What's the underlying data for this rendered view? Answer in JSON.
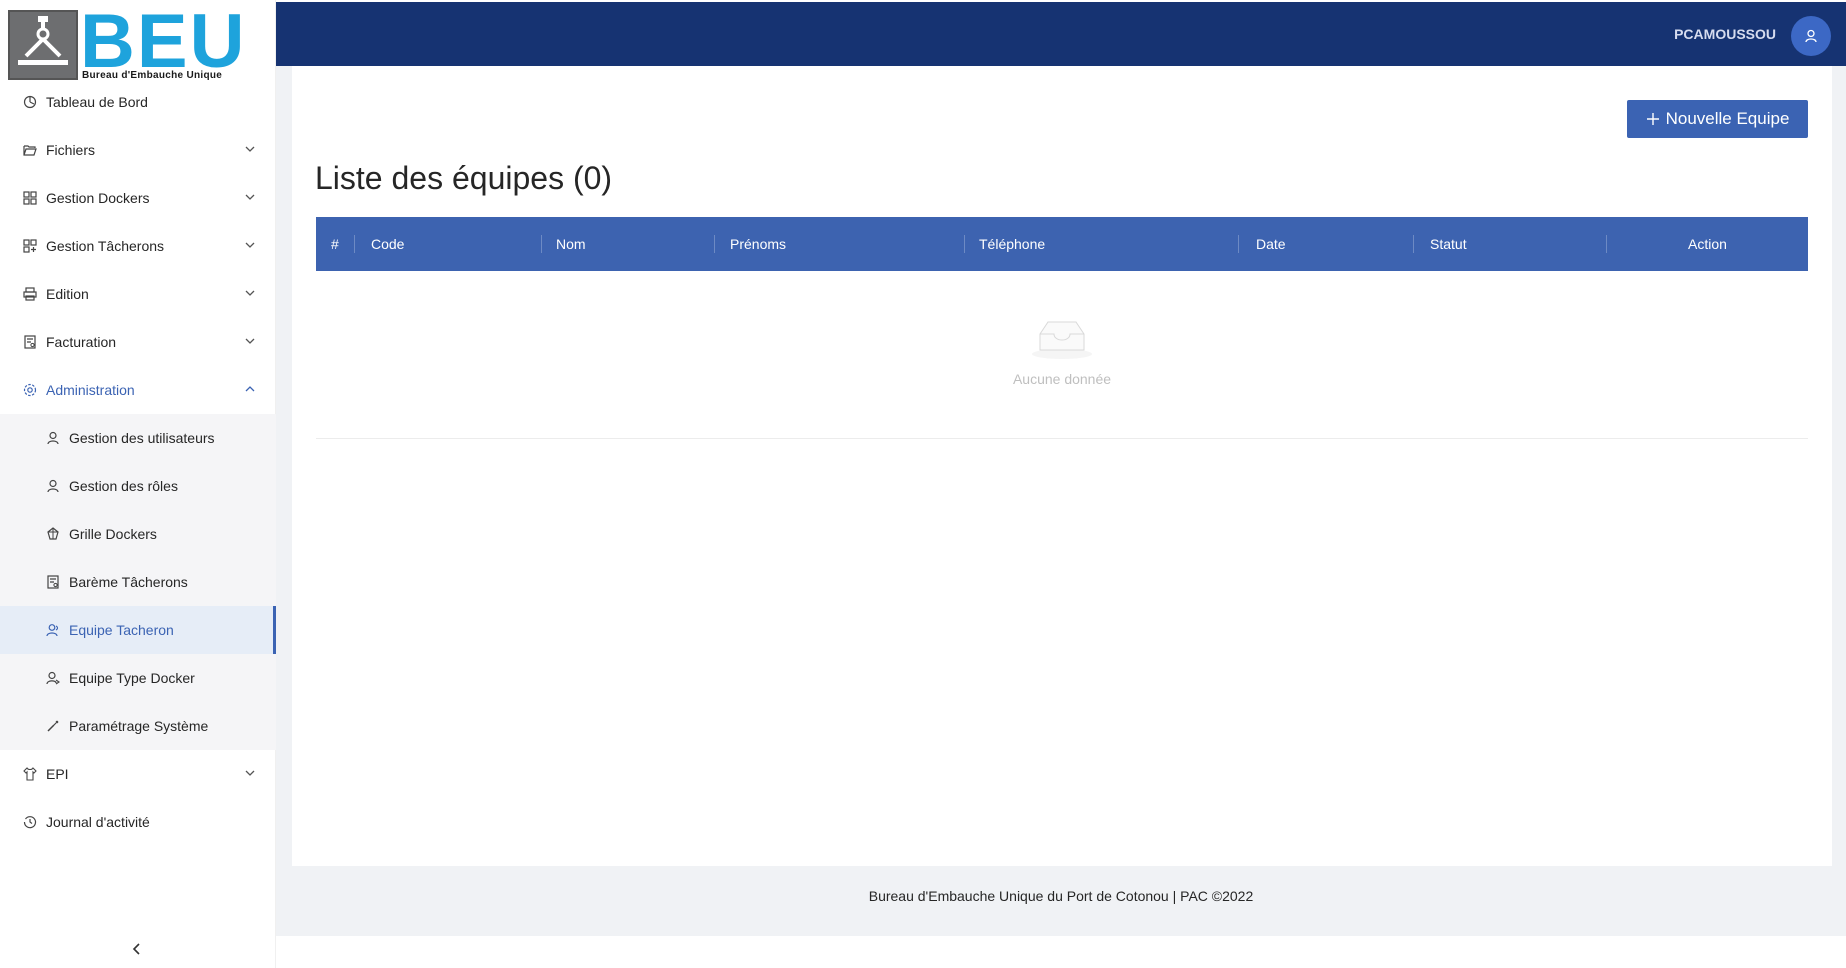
{
  "brand": {
    "logo_text": "BEU",
    "logo_subtitle": "Bureau d'Embauche Unique"
  },
  "header": {
    "username": "PCAMOUSSOU"
  },
  "sidebar": {
    "items": [
      {
        "label": "Tableau de Bord",
        "icon": "dashboard-icon",
        "has_children": false
      },
      {
        "label": "Fichiers",
        "icon": "folder-open-icon",
        "has_children": true
      },
      {
        "label": "Gestion Dockers",
        "icon": "appstore-icon",
        "has_children": true
      },
      {
        "label": "Gestion Tâcherons",
        "icon": "appstore-add-icon",
        "has_children": true
      },
      {
        "label": "Edition",
        "icon": "printer-icon",
        "has_children": true
      },
      {
        "label": "Facturation",
        "icon": "invoice-icon",
        "has_children": true
      },
      {
        "label": "Administration",
        "icon": "setting-icon",
        "has_children": true,
        "expanded": true
      },
      {
        "label": "EPI",
        "icon": "shirt-icon",
        "has_children": true
      },
      {
        "label": "Journal d'activité",
        "icon": "history-icon",
        "has_children": false
      }
    ],
    "admin_submenu": [
      {
        "label": "Gestion des utilisateurs",
        "icon": "user-icon"
      },
      {
        "label": "Gestion des rôles",
        "icon": "user-icon"
      },
      {
        "label": "Grille Dockers",
        "icon": "gold-icon"
      },
      {
        "label": "Barème Tâcherons",
        "icon": "audit-icon"
      },
      {
        "label": "Equipe Tacheron",
        "icon": "team-icon",
        "selected": true
      },
      {
        "label": "Equipe Type Docker",
        "icon": "user-switch-icon"
      },
      {
        "label": "Paramétrage Système",
        "icon": "tool-icon"
      }
    ]
  },
  "main": {
    "new_button_label": "Nouvelle Equipe",
    "title": "Liste des équipes (0)",
    "table": {
      "columns": [
        "#",
        "Code",
        "Nom",
        "Prénoms",
        "Téléphone",
        "Date",
        "Statut",
        "Action"
      ],
      "rows": [],
      "empty_text": "Aucune donnée"
    }
  },
  "footer": {
    "text": "Bureau d'Embauche Unique du Port de Cotonou | PAC ©2022"
  },
  "colors": {
    "topbar": "#163372",
    "accent": "#3b63b3",
    "table_header": "#3d63b0",
    "logo_blue": "#1ea3dc"
  }
}
